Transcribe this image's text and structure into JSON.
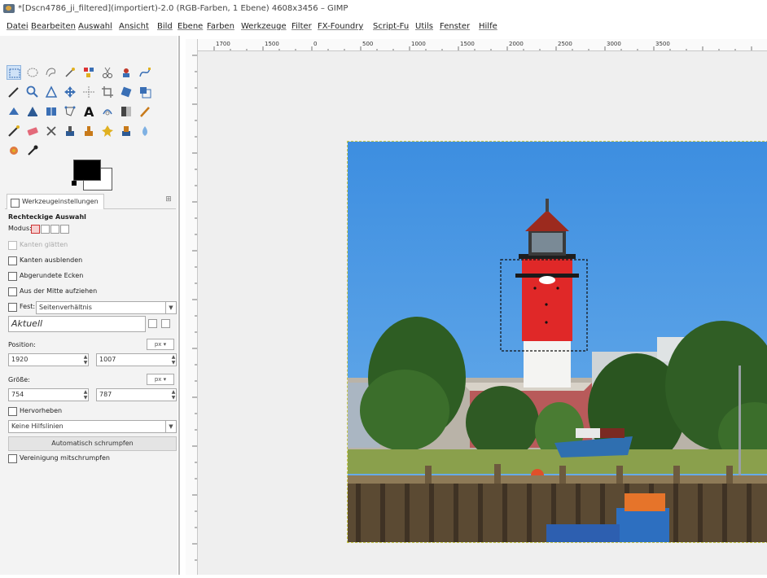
{
  "window": {
    "title": "*[Dscn4786_ji_filtered](importiert)-2.0 (RGB-Farben, 1 Ebene) 4608x3456 – GIMP"
  },
  "menu": [
    "Datei",
    "Bearbeiten",
    "Auswahl",
    "Ansicht",
    "Bild",
    "Ebene",
    "Farben",
    "Werkzeuge",
    "Filter",
    "FX-Foundry",
    "Script-Fu",
    "Utils",
    "Fenster",
    "Hilfe"
  ],
  "colors": {
    "foreground": "#000000",
    "background": "#ffffff",
    "selection_accent": "#cfe2f7"
  },
  "tool_options": {
    "tab_label": "Werkzeugeinstellungen",
    "tool_name": "Rechteckige Auswahl",
    "mode_label": "Modus:",
    "antialias_label": "Kanten glätten",
    "feather_label": "Kanten ausblenden",
    "rounded_label": "Abgerundete Ecken",
    "from_center_label": "Aus der Mitte aufziehen",
    "fixed_label": "Fest:",
    "fixed_value": "Seitenverhältnis",
    "aspect_value": "Aktuell",
    "position_label": "Position:",
    "position_unit": "px",
    "position_x": "1920",
    "position_y": "1007",
    "size_label": "Größe:",
    "size_unit": "px",
    "size_w": "754",
    "size_h": "787",
    "highlight_label": "Hervorheben",
    "guides_value": "Keine Hilfslinien",
    "autoshrink_label": "Automatisch schrumpfen",
    "shrink_merged_label": "Vereinigung mitschrumpfen"
  },
  "ruler": {
    "h_ticks": [
      "1700",
      "1500",
      "0",
      "500",
      "1000",
      "1500",
      "2000",
      "2500",
      "3000",
      "3500"
    ]
  },
  "icons": [
    "rect-select-icon",
    "ellipse-select-icon",
    "free-select-icon",
    "fuzzy-select-icon",
    "color-picker-icon",
    "scissors-icon",
    "foreground-select-icon",
    "paths-icon",
    "pencil-icon",
    "zoom-icon",
    "measure-icon",
    "move-icon",
    "align-icon",
    "crop-icon",
    "rotate-icon",
    "scale-icon",
    "bucket-fill-icon",
    "gradient-icon",
    "text-icon",
    "heal-icon",
    "clone-icon",
    "perspective-clone-icon",
    "paintbrush-icon",
    "eraser-icon",
    "airbrush-icon",
    "ink-icon",
    "smudge-icon",
    "dodge-icon",
    "blur-icon",
    "flip-icon",
    "cage-icon",
    "warp-icon"
  ]
}
